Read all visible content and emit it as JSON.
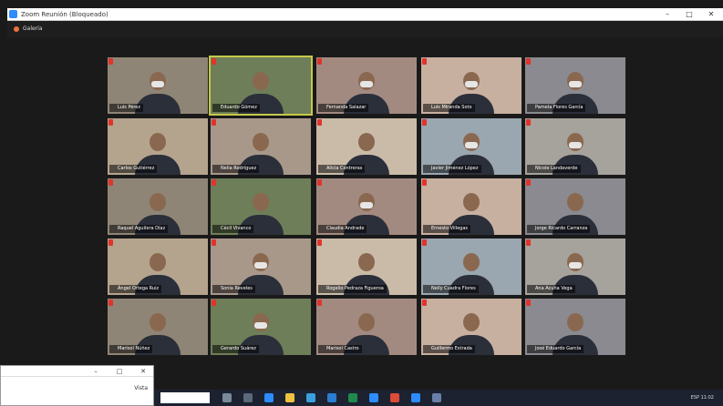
{
  "window": {
    "title": "Zoom Reunión (Bloqueado)",
    "minimize": "–",
    "maximize": "□",
    "close": "✕"
  },
  "meeting": {
    "view_label": "Galería"
  },
  "participants": [
    {
      "name": "Luis Pérez"
    },
    {
      "name": "Eduardo Gómez"
    },
    {
      "name": "Fernanda Salazar"
    },
    {
      "name": "Luis Miranda Soto"
    },
    {
      "name": "Pamela Flores García"
    },
    {
      "name": "Carlos Gutiérrez"
    },
    {
      "name": "Nelia Rodríguez"
    },
    {
      "name": "Alicia Contreras"
    },
    {
      "name": "Javier Jiménez López"
    },
    {
      "name": "Nicole Landaverde"
    },
    {
      "name": "Raquel Aguilera Díaz"
    },
    {
      "name": "Cécil Vivanco"
    },
    {
      "name": "Claudia Andrade"
    },
    {
      "name": "Ernesto Villegas"
    },
    {
      "name": "Jorge Ricardo Carranza"
    },
    {
      "name": "Ángel Ortega Ruiz"
    },
    {
      "name": "Sonia Reveles"
    },
    {
      "name": "Rogelio Pedraza Figueroa"
    },
    {
      "name": "Nelly Cuadra Flores"
    },
    {
      "name": "Ana Acuña Vega"
    },
    {
      "name": "Marisol Núñez"
    },
    {
      "name": "Gerardo Suárez"
    },
    {
      "name": "Marisol Castro"
    },
    {
      "name": "Guillermo Estrada"
    },
    {
      "name": "José Eduardo García"
    }
  ],
  "second_window": {
    "option_label": "Vista"
  },
  "taskbar": {
    "tray_text": "ESP 11:02"
  },
  "colors": {
    "active_speaker_border": "#c6c94a",
    "muted_mic": "#e0342c",
    "zoom_blue": "#2d8cff"
  }
}
